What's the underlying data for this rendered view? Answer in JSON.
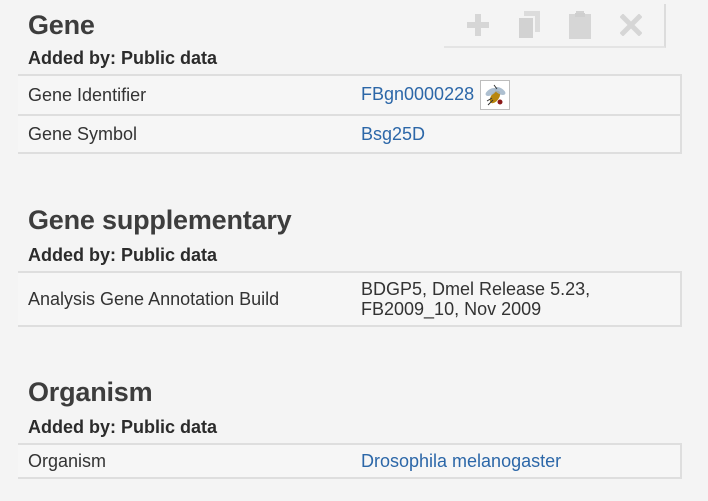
{
  "toolbar": {
    "icons": [
      "plus-icon",
      "copy-icon",
      "clipboard-icon",
      "close-icon"
    ]
  },
  "sections": {
    "gene": {
      "title": "Gene",
      "added_by": "Added by: Public data",
      "rows": [
        {
          "label": "Gene Identifier",
          "value": "FBgn0000228",
          "icon": "flybase-fly-icon"
        },
        {
          "label": "Gene Symbol",
          "value": "Bsg25D"
        }
      ]
    },
    "supplementary": {
      "title": "Gene supplementary",
      "added_by": "Added by: Public data",
      "rows": [
        {
          "label": "Analysis Gene Annotation Build",
          "value_line1": "BDGP5, Dmel Release 5.23,",
          "value_line2": "FB2009_10, Nov 2009"
        }
      ]
    },
    "organism": {
      "title": "Organism",
      "added_by": "Added by: Public data",
      "rows": [
        {
          "label": "Organism",
          "value": "Drosophila melanogaster"
        }
      ]
    }
  },
  "colors": {
    "link": "#2c67a8",
    "toolbar_icon": "#d9d9d9",
    "border": "#dedede"
  }
}
